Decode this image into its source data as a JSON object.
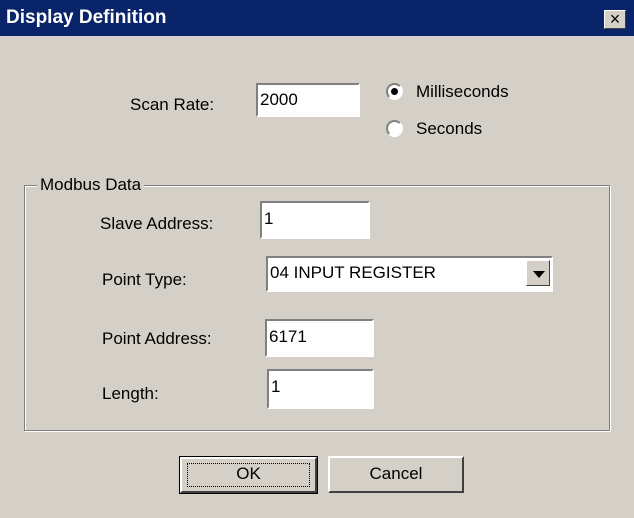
{
  "window": {
    "title": "Display Definition",
    "close_glyph": "×"
  },
  "scan": {
    "label": "Scan Rate:",
    "value": "2000",
    "options": [
      {
        "label": "Milliseconds",
        "selected": true
      },
      {
        "label": "Seconds",
        "selected": false
      }
    ]
  },
  "modbus": {
    "group_title": "Modbus Data",
    "slave_address_label": "Slave Address:",
    "slave_address_value": "1",
    "point_type_label": "Point Type:",
    "point_type_value": "04 INPUT REGISTER",
    "point_address_label": "Point Address:",
    "point_address_value": "6171",
    "length_label": "Length:",
    "length_value": "1"
  },
  "buttons": {
    "ok": "OK",
    "cancel": "Cancel"
  }
}
